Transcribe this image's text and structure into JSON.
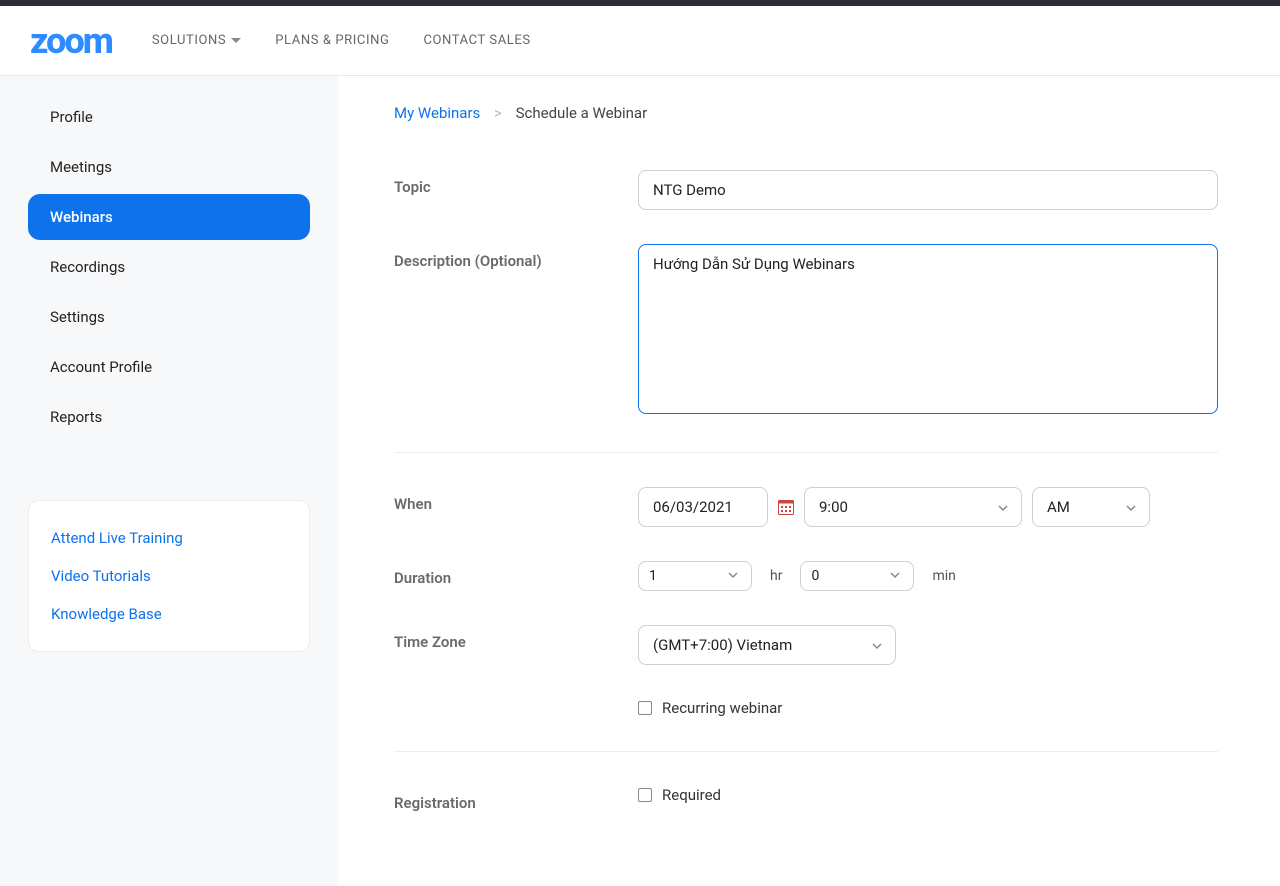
{
  "brand": "zoom",
  "topnav": {
    "solutions": "SOLUTIONS",
    "plans": "PLANS & PRICING",
    "contact": "CONTACT SALES"
  },
  "sidebar": {
    "items": [
      {
        "label": "Profile"
      },
      {
        "label": "Meetings"
      },
      {
        "label": "Webinars"
      },
      {
        "label": "Recordings"
      },
      {
        "label": "Settings"
      },
      {
        "label": "Account Profile"
      },
      {
        "label": "Reports"
      }
    ],
    "help": {
      "live": "Attend Live Training",
      "video": "Video Tutorials",
      "kb": "Knowledge Base"
    }
  },
  "breadcrumb": {
    "parent": "My Webinars",
    "sep": ">",
    "current": "Schedule a Webinar"
  },
  "form": {
    "topic_label": "Topic",
    "topic_value": "NTG Demo",
    "desc_label": "Description (Optional)",
    "desc_value": "Hướng Dẫn Sử Dụng Webinars",
    "when_label": "When",
    "date_value": "06/03/2021",
    "time_value": "9:00",
    "ampm_value": "AM",
    "duration_label": "Duration",
    "hours_value": "1",
    "hr_unit": "hr",
    "minutes_value": "0",
    "min_unit": "min",
    "tz_label": "Time Zone",
    "tz_value": "(GMT+7:00) Vietnam",
    "recurring_label": "Recurring webinar",
    "registration_label": "Registration",
    "required_label": "Required"
  }
}
